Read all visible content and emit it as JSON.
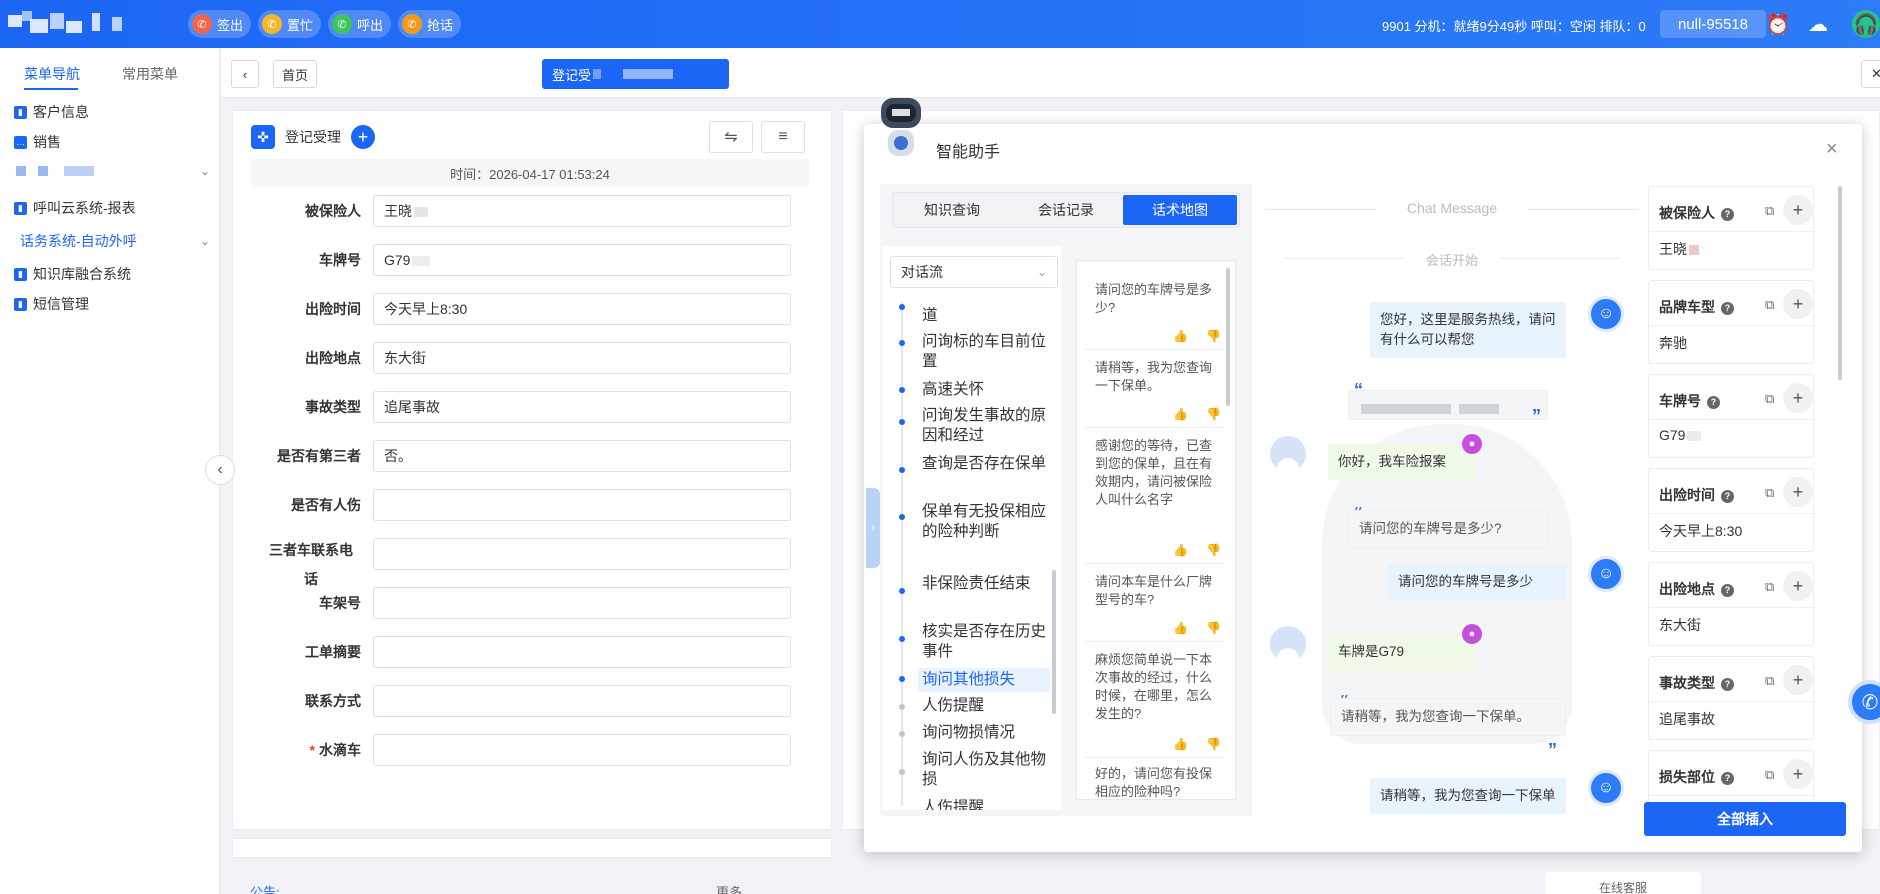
{
  "topbar": {
    "actions": [
      {
        "label": "签出",
        "color": "#f0654b",
        "icon": "phone-icon"
      },
      {
        "label": "置忙",
        "color": "#f3b72d",
        "icon": "phone-icon"
      },
      {
        "label": "呼出",
        "color": "#3cc65c",
        "icon": "phone-icon"
      },
      {
        "label": "抢话",
        "color": "#f39a1e",
        "icon": "phone-icon"
      }
    ],
    "status": "9901  分机：就绪9分49秒  呼叫：空闲  排队：0",
    "extension": "null-95518"
  },
  "sidebar": {
    "tabs": [
      "菜单导航",
      "常用菜单"
    ],
    "items": [
      {
        "label": "客户信息"
      },
      {
        "label": "销售"
      },
      {
        "label": ""
      },
      {
        "label": "呼叫云系统-报表"
      },
      {
        "label": "话务系统-自动外呼"
      },
      {
        "label": "知识库融合系统"
      },
      {
        "label": "短信管理"
      }
    ]
  },
  "navbar": {
    "home": "首页",
    "active_tab": "登记受"
  },
  "form": {
    "title": "登记受理",
    "time": "时间：2026-04-17 01:53:24",
    "fields": [
      {
        "label": "被保险人",
        "value": "王晓",
        "required": false
      },
      {
        "label": "车牌号",
        "value": "G79",
        "required": false
      },
      {
        "label": "出险时间",
        "value": "今天早上8:30",
        "required": false
      },
      {
        "label": "出险地点",
        "value": "东大街",
        "required": false
      },
      {
        "label": "事故类型",
        "value": "追尾事故",
        "required": false
      },
      {
        "label": "是否有第三者",
        "value": "否。",
        "required": false
      },
      {
        "label": "是否有人伤",
        "value": "",
        "required": false
      },
      {
        "label": "三者车联系电话",
        "value": "",
        "required": false
      },
      {
        "label": "车架号",
        "value": "",
        "required": false
      },
      {
        "label": "工单摘要",
        "value": "",
        "required": false
      },
      {
        "label": "联系方式",
        "value": "",
        "required": false
      },
      {
        "label": "水滴车",
        "value": "",
        "required": true
      }
    ]
  },
  "footer": {
    "notice": "公告:",
    "more": "更多",
    "online": "在线客服"
  },
  "assistant": {
    "title": "智能助手",
    "tabs": [
      "知识查询",
      "会话记录",
      "话术地图"
    ],
    "active_tab": 2,
    "flow_select": "对话流",
    "flow_items": [
      {
        "label": "道",
        "active": false,
        "grey": false
      },
      {
        "label": "问询标的车目前位置",
        "active": false,
        "grey": false
      },
      {
        "label": "高速关怀",
        "active": false,
        "grey": false
      },
      {
        "label": "问询发生事故的原因和经过",
        "active": false,
        "grey": false
      },
      {
        "label": "查询是否存在保单",
        "active": false,
        "grey": false
      },
      {
        "label": "保单有无投保相应的险种判断",
        "active": false,
        "grey": false
      },
      {
        "label": "非保险责任结束",
        "active": false,
        "grey": false
      },
      {
        "label": "核实是否存在历史事件",
        "active": false,
        "grey": false
      },
      {
        "label": "询问其他损失",
        "active": true,
        "grey": false
      },
      {
        "label": "人伤提醒",
        "active": false,
        "grey": true
      },
      {
        "label": "询问物损情况",
        "active": false,
        "grey": true
      },
      {
        "label": "询问人伤及其他物损",
        "active": false,
        "grey": true
      },
      {
        "label": "人伤提醒",
        "active": false,
        "grey": true
      }
    ],
    "scripts": [
      "请问您的车牌号是多少?",
      "请稍等，我为您查询一下保单。",
      "感谢您的等待，已查到您的保单，且在有效期内，请问被保险人叫什么名字",
      "请问本车是什么厂牌型号的车?",
      "麻烦您简单说一下本次事故的经过，什么时候，在哪里，怎么发生的?",
      "好的，请问您有投保相应的险种吗?"
    ],
    "chat": {
      "title": "Chat Message",
      "start": "会话开始",
      "messages": [
        {
          "who": "agent",
          "text": "您好，这里是服务热线，请问有什么可以帮您"
        },
        {
          "who": "hint",
          "text": ""
        },
        {
          "who": "cust",
          "text": "你好，我车险报案"
        },
        {
          "who": "hint",
          "text": "请问您的车牌号是多少?"
        },
        {
          "who": "agent",
          "text": "请问您的车牌号是多少"
        },
        {
          "who": "cust",
          "text": "车牌是G79"
        },
        {
          "who": "hint",
          "text": "请稍等，我为您查询一下保单。"
        },
        {
          "who": "agent",
          "text": "请稍等，我为您查询一下保单"
        }
      ]
    },
    "fields": [
      {
        "label": "被保险人",
        "value": "王晓"
      },
      {
        "label": "品牌车型",
        "value": "奔驰"
      },
      {
        "label": "车牌号",
        "value": "G79"
      },
      {
        "label": "出险时间",
        "value": "今天早上8:30"
      },
      {
        "label": "出险地点",
        "value": "东大街"
      },
      {
        "label": "事故类型",
        "value": "追尾事故"
      },
      {
        "label": "损失部位",
        "value": ""
      }
    ],
    "insert_all": "全部插入"
  }
}
